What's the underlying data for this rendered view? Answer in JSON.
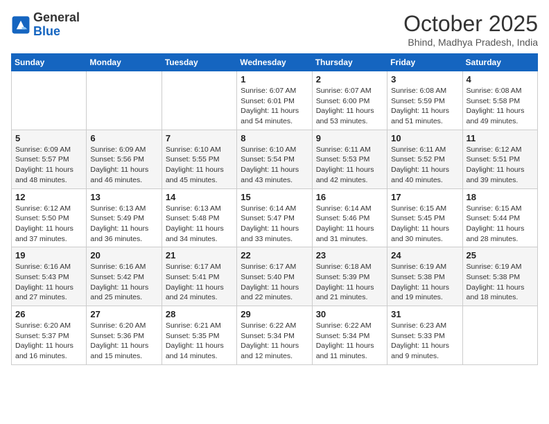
{
  "header": {
    "logo_general": "General",
    "logo_blue": "Blue",
    "month": "October 2025",
    "location": "Bhind, Madhya Pradesh, India"
  },
  "days_of_week": [
    "Sunday",
    "Monday",
    "Tuesday",
    "Wednesday",
    "Thursday",
    "Friday",
    "Saturday"
  ],
  "weeks": [
    [
      {
        "day": "",
        "info": ""
      },
      {
        "day": "",
        "info": ""
      },
      {
        "day": "",
        "info": ""
      },
      {
        "day": "1",
        "info": "Sunrise: 6:07 AM\nSunset: 6:01 PM\nDaylight: 11 hours\nand 54 minutes."
      },
      {
        "day": "2",
        "info": "Sunrise: 6:07 AM\nSunset: 6:00 PM\nDaylight: 11 hours\nand 53 minutes."
      },
      {
        "day": "3",
        "info": "Sunrise: 6:08 AM\nSunset: 5:59 PM\nDaylight: 11 hours\nand 51 minutes."
      },
      {
        "day": "4",
        "info": "Sunrise: 6:08 AM\nSunset: 5:58 PM\nDaylight: 11 hours\nand 49 minutes."
      }
    ],
    [
      {
        "day": "5",
        "info": "Sunrise: 6:09 AM\nSunset: 5:57 PM\nDaylight: 11 hours\nand 48 minutes."
      },
      {
        "day": "6",
        "info": "Sunrise: 6:09 AM\nSunset: 5:56 PM\nDaylight: 11 hours\nand 46 minutes."
      },
      {
        "day": "7",
        "info": "Sunrise: 6:10 AM\nSunset: 5:55 PM\nDaylight: 11 hours\nand 45 minutes."
      },
      {
        "day": "8",
        "info": "Sunrise: 6:10 AM\nSunset: 5:54 PM\nDaylight: 11 hours\nand 43 minutes."
      },
      {
        "day": "9",
        "info": "Sunrise: 6:11 AM\nSunset: 5:53 PM\nDaylight: 11 hours\nand 42 minutes."
      },
      {
        "day": "10",
        "info": "Sunrise: 6:11 AM\nSunset: 5:52 PM\nDaylight: 11 hours\nand 40 minutes."
      },
      {
        "day": "11",
        "info": "Sunrise: 6:12 AM\nSunset: 5:51 PM\nDaylight: 11 hours\nand 39 minutes."
      }
    ],
    [
      {
        "day": "12",
        "info": "Sunrise: 6:12 AM\nSunset: 5:50 PM\nDaylight: 11 hours\nand 37 minutes."
      },
      {
        "day": "13",
        "info": "Sunrise: 6:13 AM\nSunset: 5:49 PM\nDaylight: 11 hours\nand 36 minutes."
      },
      {
        "day": "14",
        "info": "Sunrise: 6:13 AM\nSunset: 5:48 PM\nDaylight: 11 hours\nand 34 minutes."
      },
      {
        "day": "15",
        "info": "Sunrise: 6:14 AM\nSunset: 5:47 PM\nDaylight: 11 hours\nand 33 minutes."
      },
      {
        "day": "16",
        "info": "Sunrise: 6:14 AM\nSunset: 5:46 PM\nDaylight: 11 hours\nand 31 minutes."
      },
      {
        "day": "17",
        "info": "Sunrise: 6:15 AM\nSunset: 5:45 PM\nDaylight: 11 hours\nand 30 minutes."
      },
      {
        "day": "18",
        "info": "Sunrise: 6:15 AM\nSunset: 5:44 PM\nDaylight: 11 hours\nand 28 minutes."
      }
    ],
    [
      {
        "day": "19",
        "info": "Sunrise: 6:16 AM\nSunset: 5:43 PM\nDaylight: 11 hours\nand 27 minutes."
      },
      {
        "day": "20",
        "info": "Sunrise: 6:16 AM\nSunset: 5:42 PM\nDaylight: 11 hours\nand 25 minutes."
      },
      {
        "day": "21",
        "info": "Sunrise: 6:17 AM\nSunset: 5:41 PM\nDaylight: 11 hours\nand 24 minutes."
      },
      {
        "day": "22",
        "info": "Sunrise: 6:17 AM\nSunset: 5:40 PM\nDaylight: 11 hours\nand 22 minutes."
      },
      {
        "day": "23",
        "info": "Sunrise: 6:18 AM\nSunset: 5:39 PM\nDaylight: 11 hours\nand 21 minutes."
      },
      {
        "day": "24",
        "info": "Sunrise: 6:19 AM\nSunset: 5:38 PM\nDaylight: 11 hours\nand 19 minutes."
      },
      {
        "day": "25",
        "info": "Sunrise: 6:19 AM\nSunset: 5:38 PM\nDaylight: 11 hours\nand 18 minutes."
      }
    ],
    [
      {
        "day": "26",
        "info": "Sunrise: 6:20 AM\nSunset: 5:37 PM\nDaylight: 11 hours\nand 16 minutes."
      },
      {
        "day": "27",
        "info": "Sunrise: 6:20 AM\nSunset: 5:36 PM\nDaylight: 11 hours\nand 15 minutes."
      },
      {
        "day": "28",
        "info": "Sunrise: 6:21 AM\nSunset: 5:35 PM\nDaylight: 11 hours\nand 14 minutes."
      },
      {
        "day": "29",
        "info": "Sunrise: 6:22 AM\nSunset: 5:34 PM\nDaylight: 11 hours\nand 12 minutes."
      },
      {
        "day": "30",
        "info": "Sunrise: 6:22 AM\nSunset: 5:34 PM\nDaylight: 11 hours\nand 11 minutes."
      },
      {
        "day": "31",
        "info": "Sunrise: 6:23 AM\nSunset: 5:33 PM\nDaylight: 11 hours\nand 9 minutes."
      },
      {
        "day": "",
        "info": ""
      }
    ]
  ]
}
